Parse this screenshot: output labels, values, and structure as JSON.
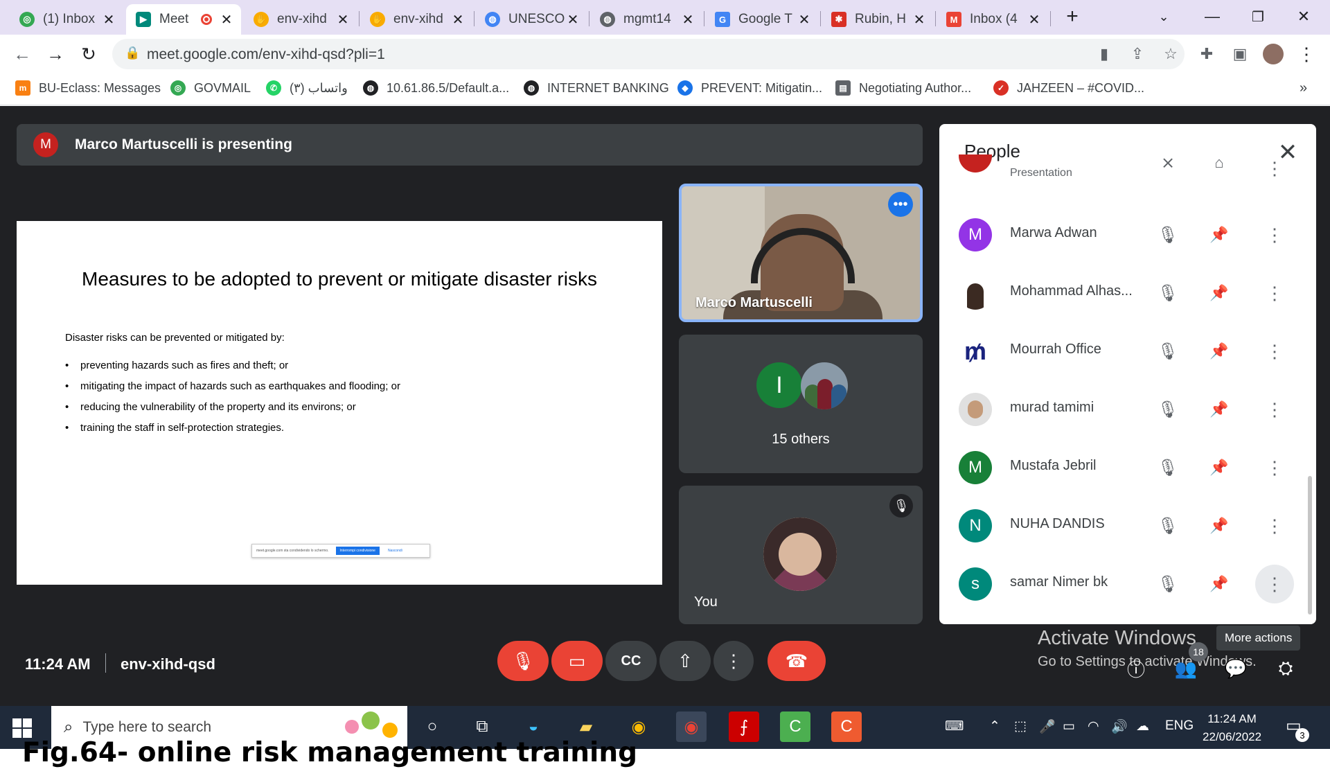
{
  "tabs": [
    {
      "title": "(1) Inbox",
      "icon": "whatsapp-ring-icon",
      "color": "#34a853"
    },
    {
      "title": "Meet",
      "icon": "google-meet-icon",
      "color": "#00897b",
      "recording": true
    },
    {
      "title": "env-xihd",
      "icon": "hand-icon",
      "color": "#f9ab00"
    },
    {
      "title": "env-xihd",
      "icon": "hand-icon",
      "color": "#f9ab00"
    },
    {
      "title": "UNESCO",
      "icon": "globe-blue-icon",
      "color": "#4285f4"
    },
    {
      "title": "mgmt14",
      "icon": "globe-icon",
      "color": "#5f6368"
    },
    {
      "title": "Google T",
      "icon": "google-translate-icon",
      "color": "#4285f4"
    },
    {
      "title": "Rubin, H",
      "icon": "rubin-icon",
      "color": "#d93025"
    },
    {
      "title": "Inbox (4",
      "icon": "gmail-icon",
      "color": "#ea4335"
    }
  ],
  "omnibox": {
    "url": "meet.google.com/env-xihd-qsd?pli=1"
  },
  "bookmarks": [
    {
      "label": "BU-Eclass: Messages",
      "icon": "moodle-icon",
      "color": "#f98012"
    },
    {
      "label": "GOVMAIL",
      "icon": "govmail-icon",
      "color": "#34a853"
    },
    {
      "label": "واتساب (٣)",
      "icon": "whatsapp-icon",
      "color": "#25d366"
    },
    {
      "label": "10.61.86.5/Default.a...",
      "icon": "globe-icon",
      "color": "#202124"
    },
    {
      "label": "INTERNET BANKING",
      "icon": "globe-icon",
      "color": "#202124"
    },
    {
      "label": "PREVENT: Mitigatin...",
      "icon": "drop-icon",
      "color": "#1a73e8"
    },
    {
      "label": "Negotiating Author...",
      "icon": "doc-icon",
      "color": "#5f6368"
    },
    {
      "label": "JAHZEEN – #COVID...",
      "icon": "check-icon",
      "color": "#d93025"
    }
  ],
  "banner": {
    "initial": "M",
    "text": "Marco Martuscelli is presenting"
  },
  "slide": {
    "title": "Measures to be adopted to prevent or mitigate disaster risks",
    "intro": "Disaster risks can be prevented or mitigated by:",
    "bullets": [
      "preventing hazards such as fires and theft; or",
      "mitigating the impact of hazards such as earthquakes and flooding; or",
      "reducing the vulnerability of the property and its environs; or",
      "training the staff in self-protection strategies."
    ],
    "share_bar": {
      "text": "meet.google.com sta condividendo lo schermo.",
      "stop": "Interrompi condivisione",
      "hide": "Nascondi"
    }
  },
  "tiles": {
    "presenter_name": "Marco Martuscelli",
    "others_initial": "I",
    "others_label": "15 others",
    "you_label": "You"
  },
  "people": {
    "title": "People",
    "partial_row_label": "Presentation",
    "rows": [
      {
        "name": "Marwa Adwan",
        "initial": "M",
        "color": "#9334e6"
      },
      {
        "name": "Mohammad Alhas...",
        "initial": "",
        "color": "#ffffff",
        "photo": true
      },
      {
        "name": "Mourrah Office",
        "initial": "",
        "color": "#ffffff",
        "logo": true
      },
      {
        "name": "murad tamimi",
        "initial": "",
        "color": "#e0e0e0",
        "photo": true
      },
      {
        "name": "Mustafa Jebril",
        "initial": "M",
        "color": "#188038"
      },
      {
        "name": "NUHA DANDIS",
        "initial": "N",
        "color": "#00897b"
      },
      {
        "name": "samar Nimer bk",
        "initial": "s",
        "color": "#00897b"
      }
    ]
  },
  "tooltip": "More actions",
  "watermark": {
    "line1": "Activate Windows",
    "line2": "Go to Settings to activate Windows."
  },
  "bottom": {
    "time": "11:24 AM",
    "meeting_code": "env-xihd-qsd",
    "people_count": "18"
  },
  "taskbar": {
    "search_placeholder": "Type here to search",
    "language": "ENG",
    "time": "11:24 AM",
    "date": "22/06/2022",
    "notifications": "3"
  },
  "caption": "Fig.64- online risk management training",
  "colors": {
    "meet_bg": "#202124",
    "tile_bg": "#3c4043",
    "danger": "#ea4335",
    "accent": "#1a73e8",
    "taskbar": "#1f2a3a"
  }
}
